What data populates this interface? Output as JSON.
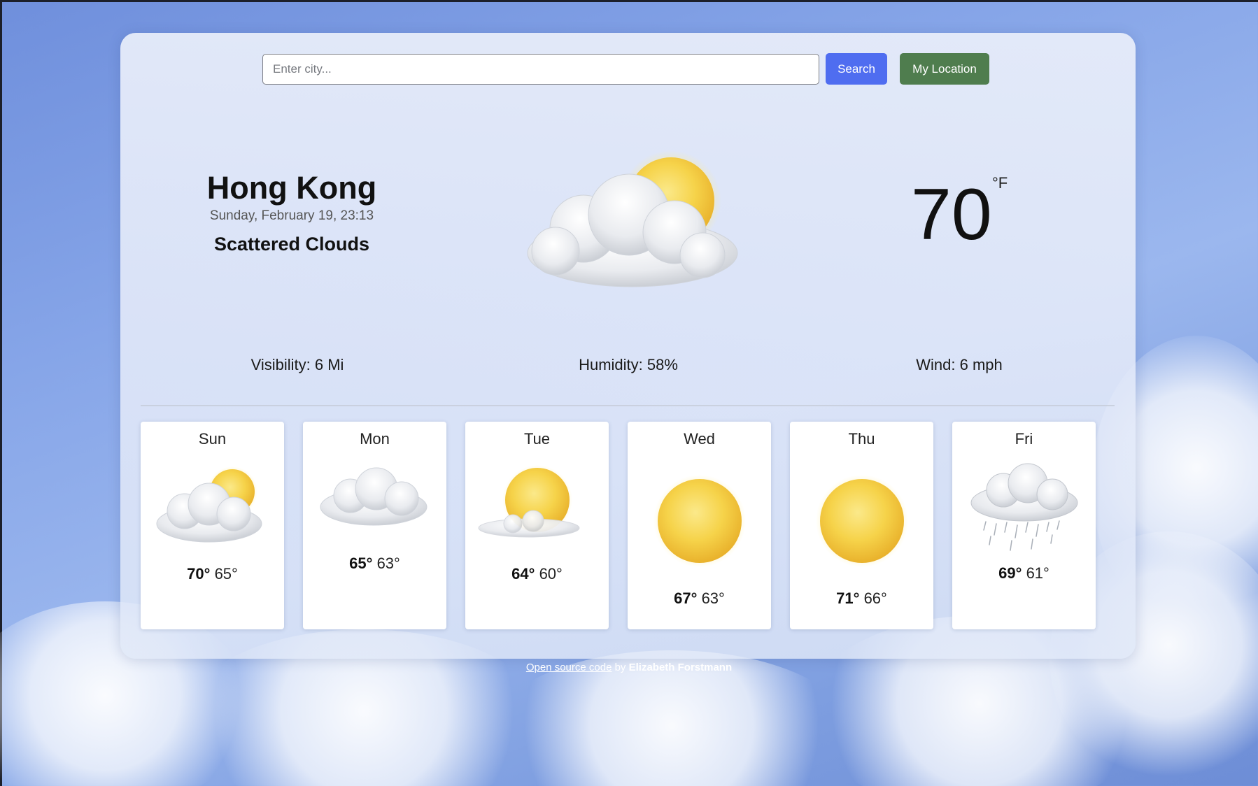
{
  "search": {
    "placeholder": "Enter city...",
    "value": "",
    "search_label": "Search",
    "location_label": "My Location",
    "search_color": "#4f6df0",
    "location_color": "#4f7d4e"
  },
  "current": {
    "city": "Hong Kong",
    "datetime": "Sunday, February 19, 23:13",
    "description": "Scattered Clouds",
    "icon": "sun-behind-cloud-icon",
    "temperature": "70",
    "unit": "°F"
  },
  "stats": {
    "visibility": "Visibility: 6 Mi",
    "humidity": "Humidity: 58%",
    "wind": "Wind: 6 mph"
  },
  "forecast": [
    {
      "day": "Sun",
      "high": "70°",
      "low": "65°",
      "icon": "sun-behind-cloud-icon"
    },
    {
      "day": "Mon",
      "high": "65°",
      "low": "63°",
      "icon": "cloud-icon"
    },
    {
      "day": "Tue",
      "high": "64°",
      "low": "60°",
      "icon": "sun-with-small-cloud-icon"
    },
    {
      "day": "Wed",
      "high": "67°",
      "low": "63°",
      "icon": "sun-icon"
    },
    {
      "day": "Thu",
      "high": "71°",
      "low": "66°",
      "icon": "sun-icon"
    },
    {
      "day": "Fri",
      "high": "69°",
      "low": "61°",
      "icon": "rain-cloud-icon"
    }
  ],
  "footer": {
    "link_text": "Open source code",
    "by_text": "by",
    "author": "Elizabeth Forstmann"
  }
}
